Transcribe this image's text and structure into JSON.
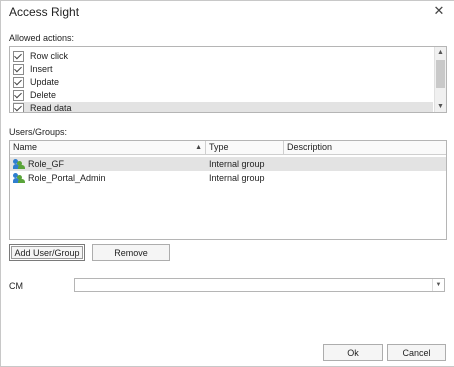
{
  "window": {
    "title": "Access Right",
    "close_glyph": "✕"
  },
  "actions": {
    "label": "Allowed actions:",
    "items": [
      {
        "label": "Row click",
        "checked": true
      },
      {
        "label": "Insert",
        "checked": true
      },
      {
        "label": "Update",
        "checked": true
      },
      {
        "label": "Delete",
        "checked": true
      },
      {
        "label": "Read data",
        "checked": true,
        "selected": true
      }
    ],
    "scroll_up_glyph": "▲",
    "scroll_down_glyph": "▼"
  },
  "users": {
    "label": "Users/Groups:",
    "columns": [
      "Name",
      "Type",
      "Description"
    ],
    "sort_glyph": "▲",
    "rows": [
      {
        "name": "Role_GF",
        "type": "Internal group",
        "description": "",
        "selected": true,
        "icon": "user-group-icon"
      },
      {
        "name": "Role_Portal_Admin",
        "type": "Internal group",
        "description": "",
        "selected": false,
        "icon": "user-group-icon"
      }
    ],
    "add_label": "Add User/Group",
    "remove_label": "Remove"
  },
  "cm": {
    "label": "CM",
    "value": "",
    "dropdown_glyph": "▼"
  },
  "footer": {
    "ok_label": "Ok",
    "cancel_label": "Cancel"
  },
  "colors": {
    "selected_row": "#e3e3e3",
    "icon_blue": "#2f7fcf",
    "icon_green": "#5aa43a"
  }
}
